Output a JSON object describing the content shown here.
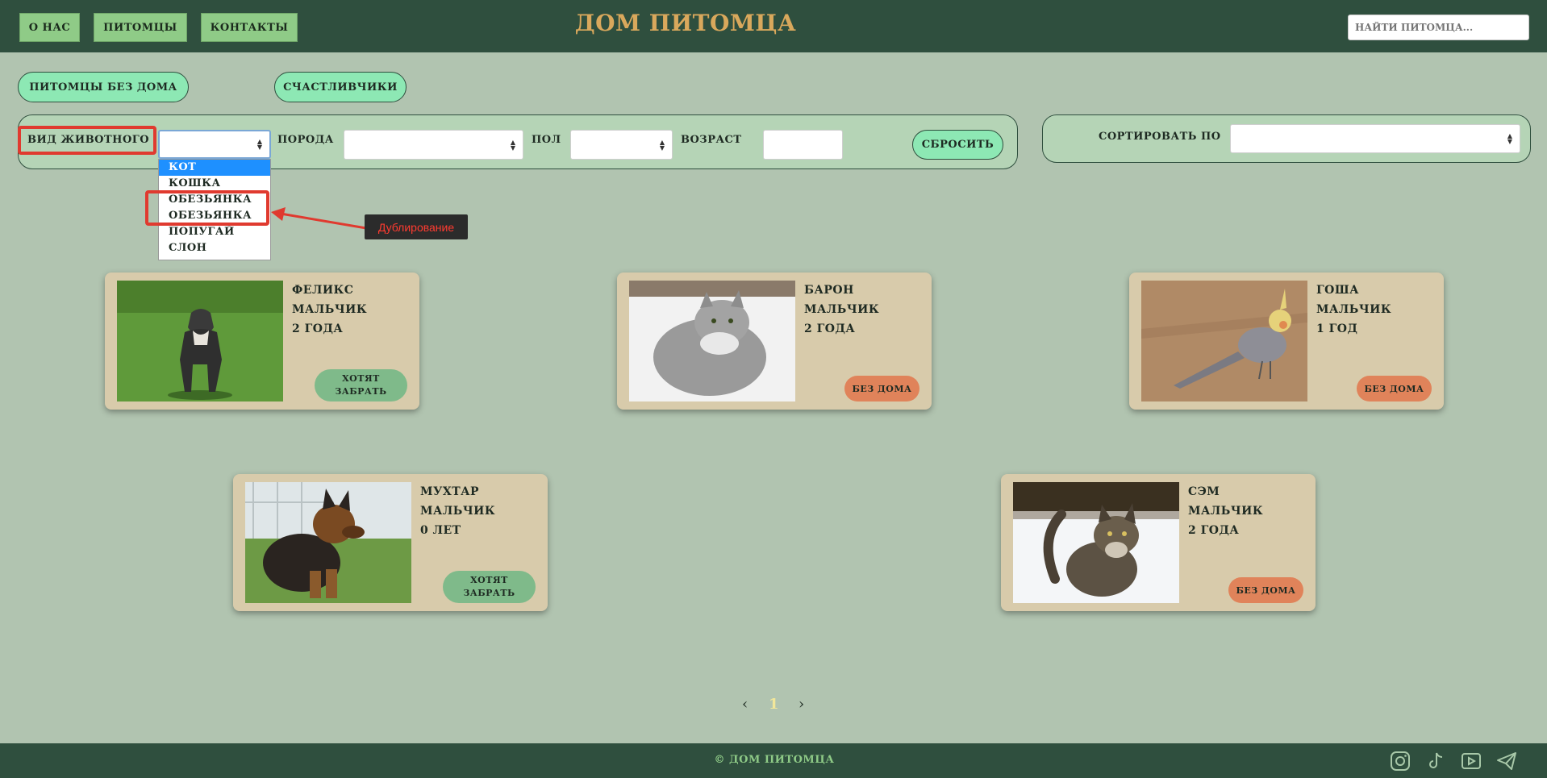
{
  "header": {
    "nav": [
      "о нас",
      "питомцы",
      "контакты"
    ],
    "title": "дом питомца",
    "search_placeholder": "найти питомца..."
  },
  "tabs": [
    "питомцы без дома",
    "счастливчики"
  ],
  "filters": {
    "species_label": "вид животного",
    "breed_label": "порода",
    "sex_label": "пол",
    "age_label": "возраст",
    "reset_label": "сбросить",
    "species_options": [
      "кот",
      "кошка",
      "обезьянка",
      "обезьянка",
      "попугай",
      "слон"
    ],
    "highlighted_option_index": 0
  },
  "sort": {
    "label": "сортировать по"
  },
  "annotation": {
    "text": "Дублирование"
  },
  "pets": [
    {
      "name": "Феликс",
      "sex": "мальчик",
      "age": "2 года",
      "status": "хотят забрать",
      "photo": "dog-photo"
    },
    {
      "name": "Барон",
      "sex": "мальчик",
      "age": "2 года",
      "status": "без дома",
      "photo": "cat-photo"
    },
    {
      "name": "Гоша",
      "sex": "мальчик",
      "age": "1 год",
      "status": "без дома",
      "photo": "parrot-photo"
    },
    {
      "name": "Мухтар",
      "sex": "мальчик",
      "age": "0 лет",
      "status": "хотят забрать",
      "photo": "puppy-photo"
    },
    {
      "name": "Сэм",
      "sex": "мальчик",
      "age": "2 года",
      "status": "без дома",
      "photo": "cat-photo"
    }
  ],
  "pagination": {
    "prev": "‹",
    "current": "1",
    "next": "›"
  },
  "footer": {
    "copyright": "© дом питомца",
    "icons": [
      "instagram-icon",
      "tiktok-icon",
      "youtube-icon",
      "telegram-icon"
    ]
  },
  "colors": {
    "background": "#b1c4b0",
    "header": "#2f4f3e",
    "nav_button": "#8fcb87",
    "tab": "#8de8b4",
    "card": "#d8cbab",
    "status_wanted": "#7fba8a",
    "status_homeless": "#e0835a",
    "title": "#d9a85c",
    "annotation": "#e03a2f"
  }
}
